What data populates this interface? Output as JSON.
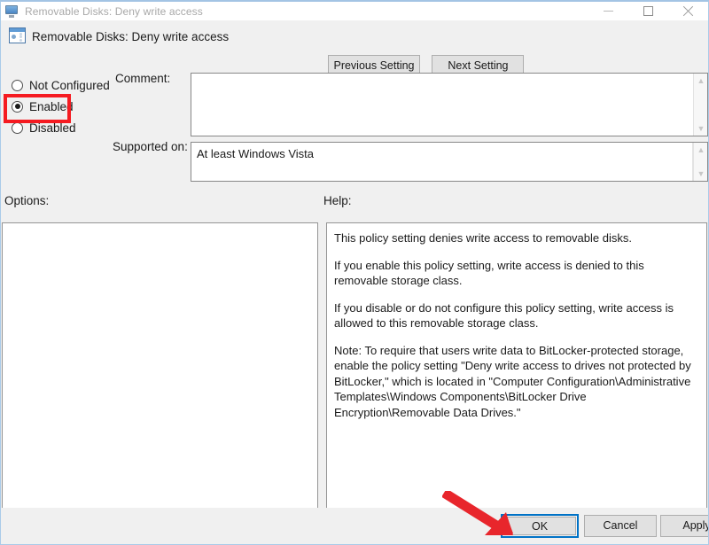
{
  "window": {
    "title": "Removable Disks: Deny write access",
    "title_icon": "monitor-icon",
    "minimize_label": "Minimize",
    "maximize_label": "Maximize",
    "close_label": "Close"
  },
  "header": {
    "icon": "policy-setting-icon",
    "title": "Removable Disks: Deny write access",
    "previous_setting_label": "Previous Setting",
    "next_setting_label": "Next Setting"
  },
  "state_options": [
    {
      "label": "Not Configured",
      "checked": false
    },
    {
      "label": "Enabled",
      "checked": true
    },
    {
      "label": "Disabled",
      "checked": false
    }
  ],
  "fields": {
    "comment_label": "Comment:",
    "comment_value": "",
    "supported_on_label": "Supported on:",
    "supported_on_value": "At least Windows Vista"
  },
  "sections": {
    "options_label": "Options:",
    "help_label": "Help:"
  },
  "options_panel": {
    "content": ""
  },
  "help_panel": {
    "paragraphs": [
      "This policy setting denies write access to removable disks.",
      "If you enable this policy setting, write access is denied to this removable storage class.",
      "If you disable or do not configure this policy setting, write access is allowed to this removable storage class.",
      "Note: To require that users write data to BitLocker-protected storage, enable the policy setting \"Deny write access to drives not protected by BitLocker,\" which is located in \"Computer Configuration\\Administrative Templates\\Windows Components\\BitLocker Drive Encryption\\Removable Data Drives.\""
    ]
  },
  "footer": {
    "ok_label": "OK",
    "cancel_label": "Cancel",
    "apply_label": "Apply"
  },
  "annotations": {
    "highlight_color": "#f51b21",
    "arrow_color": "#e8262c",
    "focus_color": "#0072c6",
    "highlight_target": "Enabled",
    "arrow_target": "OK"
  },
  "glyphs": {
    "scroll_up": "▲",
    "scroll_down": "▼"
  }
}
